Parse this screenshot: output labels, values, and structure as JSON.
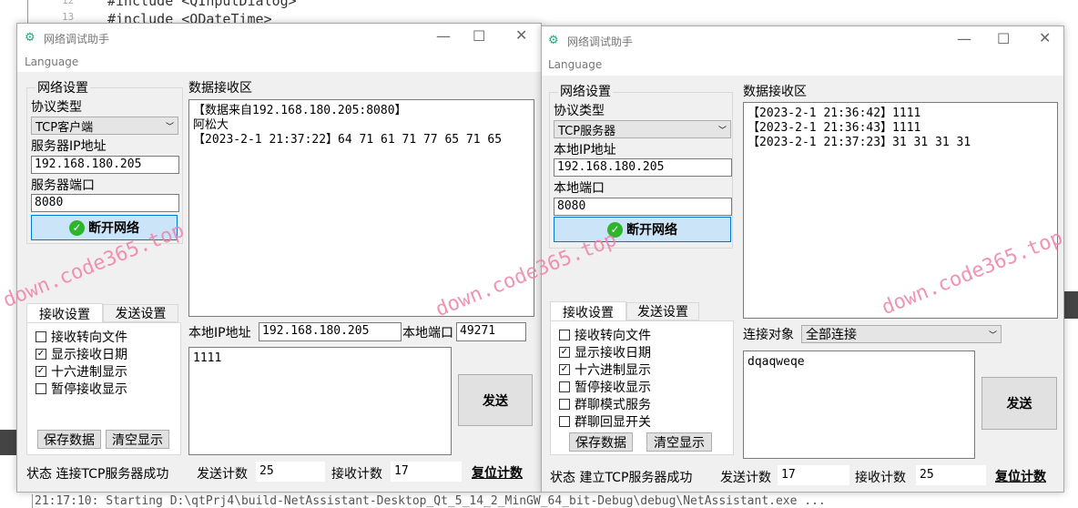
{
  "ide": {
    "line_numbers": [
      "12",
      "13"
    ],
    "code_lines": [
      "#include <QInputDialog>",
      "#include <QDateTime>"
    ],
    "console": "21:17:10: Starting D:\\qtPrj4\\build-NetAssistant-Desktop_Qt_5_14_2_MinGW_64_bit-Debug\\debug\\NetAssistant.exe ..."
  },
  "watermark": "down.code365.top",
  "client": {
    "title": "网络调试助手",
    "menu": "Language",
    "group": "网络设置",
    "protocol_label": "协议类型",
    "protocol": "TCP客户端",
    "ip_label": "服务器IP地址",
    "ip": "192.168.180.205",
    "port_label": "服务器端口",
    "port": "8080",
    "connect_button": "断开网络",
    "recv_label": "数据接收区",
    "recv_lines": [
      "【数据来自192.168.180.205:8080】",
      "阿松大",
      "【2023-2-1 21:37:22】64 71 61 71 77 65 71 65"
    ],
    "tabs": [
      "接收设置",
      "发送设置"
    ],
    "options": [
      {
        "label": "接收转向文件",
        "checked": false
      },
      {
        "label": "显示接收日期",
        "checked": true
      },
      {
        "label": "十六进制显示",
        "checked": true
      },
      {
        "label": "暂停接收显示",
        "checked": false
      }
    ],
    "save_button": "保存数据",
    "clear_button": "清空显示",
    "local_ip_label": "本地IP地址",
    "local_ip": "192.168.180.205",
    "local_port_label": "本地端口",
    "local_port": "49271",
    "send_text": "1111",
    "send_button": "发送",
    "status": "状态 连接TCP服务器成功",
    "send_count_label": "发送计数",
    "send_count": "25",
    "recv_count_label": "接收计数",
    "recv_count": "17",
    "reset_button": "复位计数"
  },
  "server": {
    "title": "网络调试助手",
    "menu": "Language",
    "group": "网络设置",
    "protocol_label": "协议类型",
    "protocol": "TCP服务器",
    "ip_label": "本地IP地址",
    "ip": "192.168.180.205",
    "port_label": "本地端口",
    "port": "8080",
    "connect_button": "断开网络",
    "recv_label": "数据接收区",
    "recv_lines": [
      "【2023-2-1 21:36:42】1111",
      "【2023-2-1 21:36:43】1111",
      "【2023-2-1 21:37:23】31 31 31 31"
    ],
    "tabs": [
      "接收设置",
      "发送设置"
    ],
    "options": [
      {
        "label": "接收转向文件",
        "checked": false
      },
      {
        "label": "显示接收日期",
        "checked": true
      },
      {
        "label": "十六进制显示",
        "checked": true
      },
      {
        "label": "暂停接收显示",
        "checked": false
      },
      {
        "label": "群聊模式服务",
        "checked": false
      },
      {
        "label": "群聊回显开关",
        "checked": false
      }
    ],
    "save_button": "保存数据",
    "clear_button": "清空显示",
    "target_label": "连接对象",
    "target": "全部连接",
    "send_text": "dqaqweqe",
    "send_button": "发送",
    "status": "状态 建立TCP服务器成功",
    "send_count_label": "发送计数",
    "send_count": "17",
    "recv_count_label": "接收计数",
    "recv_count": "25",
    "reset_button": "复位计数"
  }
}
